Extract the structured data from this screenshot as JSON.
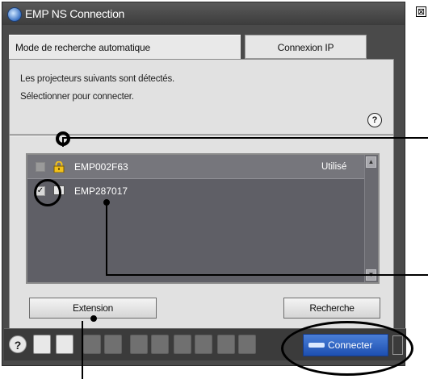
{
  "window": {
    "title": "EMP NS Connection",
    "close_glyph": "⊠"
  },
  "tabs": [
    {
      "label": "Mode de recherche automatique",
      "active": true
    },
    {
      "label": "Connexion IP",
      "active": false
    }
  ],
  "description": {
    "line1": "Les projecteurs suivants sont détectés.",
    "line2": "Sélectionner pour connecter."
  },
  "help_icon": "?",
  "projectors": [
    {
      "name": "EMP002F63",
      "status": "Utilisé",
      "checked": false,
      "icon": "lock-icon"
    },
    {
      "name": "EMP287017",
      "status": "",
      "checked": true,
      "icon": "projector-icon"
    }
  ],
  "buttons": {
    "extension": "Extension",
    "recherche": "Recherche",
    "connecter": "Connecter"
  },
  "toolbar": {
    "help": "?"
  },
  "colors": {
    "accent": "#2a5fc6",
    "panel": "#e1e1e1",
    "list_bg": "#5f5f66"
  }
}
